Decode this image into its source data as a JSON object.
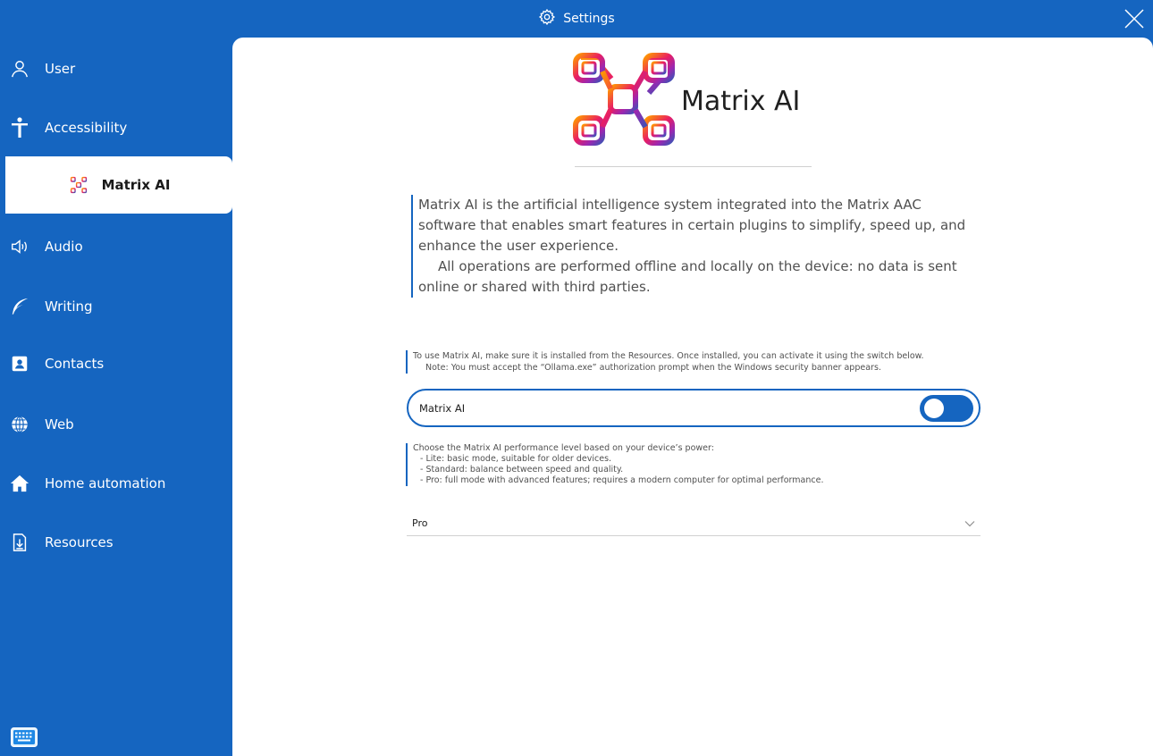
{
  "window": {
    "title": "Settings",
    "close_icon": "close-icon",
    "settings_icon": "gear-icon"
  },
  "sidebar": {
    "items": [
      {
        "label": "User",
        "icon": "user-icon"
      },
      {
        "label": "Accessibility",
        "icon": "accessibility-icon"
      },
      {
        "label": "Matrix AI",
        "icon": "matrix-ai-icon",
        "active": true
      },
      {
        "label": "Audio",
        "icon": "speaker-icon"
      },
      {
        "label": "Writing",
        "icon": "feather-icon"
      },
      {
        "label": "Contacts",
        "icon": "contacts-icon"
      },
      {
        "label": "Web",
        "icon": "globe-icon"
      },
      {
        "label": "Home automation",
        "icon": "home-icon"
      },
      {
        "label": "Resources",
        "icon": "download-file-icon"
      }
    ],
    "keyboard_icon": "keyboard-icon"
  },
  "main": {
    "logo_text": "Matrix AI",
    "description_line1": "Matrix AI is the artificial intelligence system integrated into the Matrix AAC software that enables smart features in certain plugins to simplify, speed up, and enhance the user experience.",
    "description_line2": "All operations are performed offline and locally on the device: no data is sent online or shared with third parties.",
    "install_note_line1": "To use Matrix AI, make sure it is installed from the Resources. Once installed, you can activate it using the switch below.",
    "install_note_line2": "Note: You must accept the “Ollama.exe” authorization prompt when the Windows security banner appears.",
    "toggle_label": "Matrix AI",
    "toggle_on": true,
    "levels_intro": "Choose the Matrix AI performance level based on your device’s power:",
    "level_lite": "- Lite: basic mode, suitable for older devices.",
    "level_standard": "- Standard: balance between speed and quality.",
    "level_pro": "- Pro: full mode with advanced features; requires a modern computer for optimal performance.",
    "selected_level": "Pro"
  },
  "colors": {
    "accent": "#1565c0",
    "sidebar_bg": "#1565c0",
    "content_bg": "#ffffff",
    "text_muted": "#505050"
  }
}
